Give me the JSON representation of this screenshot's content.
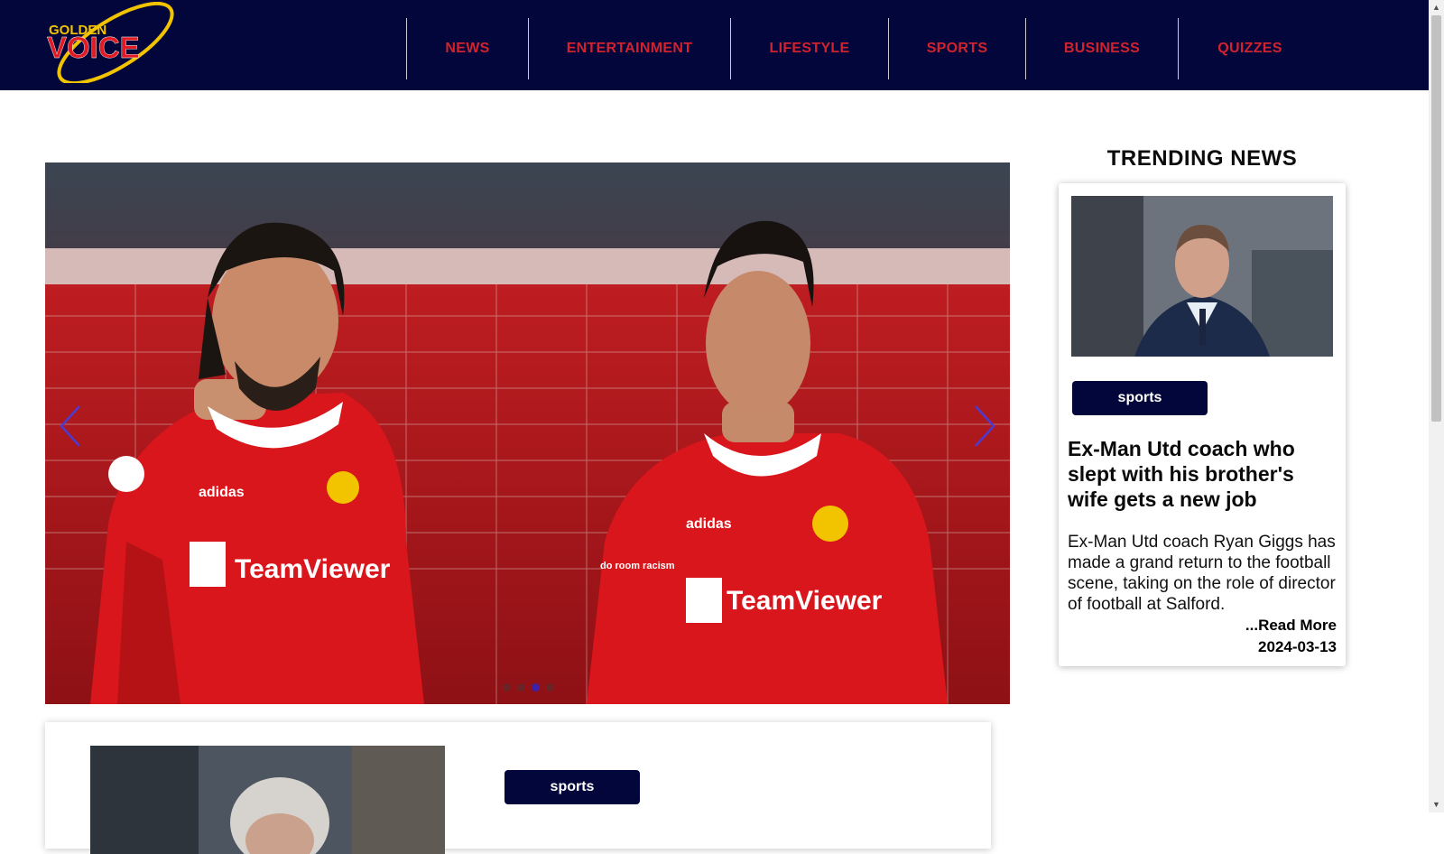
{
  "brand": {
    "logo_top": "GOLDEN",
    "logo_main": "VOICE",
    "colors": {
      "navy": "#03063a",
      "red": "#d1222e",
      "gold": "#f2c400"
    }
  },
  "nav": {
    "items": [
      {
        "label": "NEWS"
      },
      {
        "label": "ENTERTAINMENT"
      },
      {
        "label": "LIFESTYLE"
      },
      {
        "label": "SPORTS"
      },
      {
        "label": "BUSINESS"
      },
      {
        "label": "QUIZZES"
      }
    ]
  },
  "carousel": {
    "prev_icon": "chevron-left-icon",
    "next_icon": "chevron-right-icon",
    "slide_count": 4,
    "active_slide": 3,
    "jersey_sponsor": "TeamViewer",
    "sleeve_text": "do room racism",
    "brand_text": "adidas"
  },
  "trending": {
    "title": "TRENDING NEWS",
    "category": "sports",
    "headline": "Ex-Man Utd coach who slept with his brother's wife gets a new job",
    "excerpt": "Ex-Man Utd coach Ryan Giggs has made a grand return to the football scene, taking on the role of director of football at Salford.",
    "read_more": "...Read More",
    "date": "2024-03-13"
  },
  "second_article": {
    "category": "sports"
  }
}
